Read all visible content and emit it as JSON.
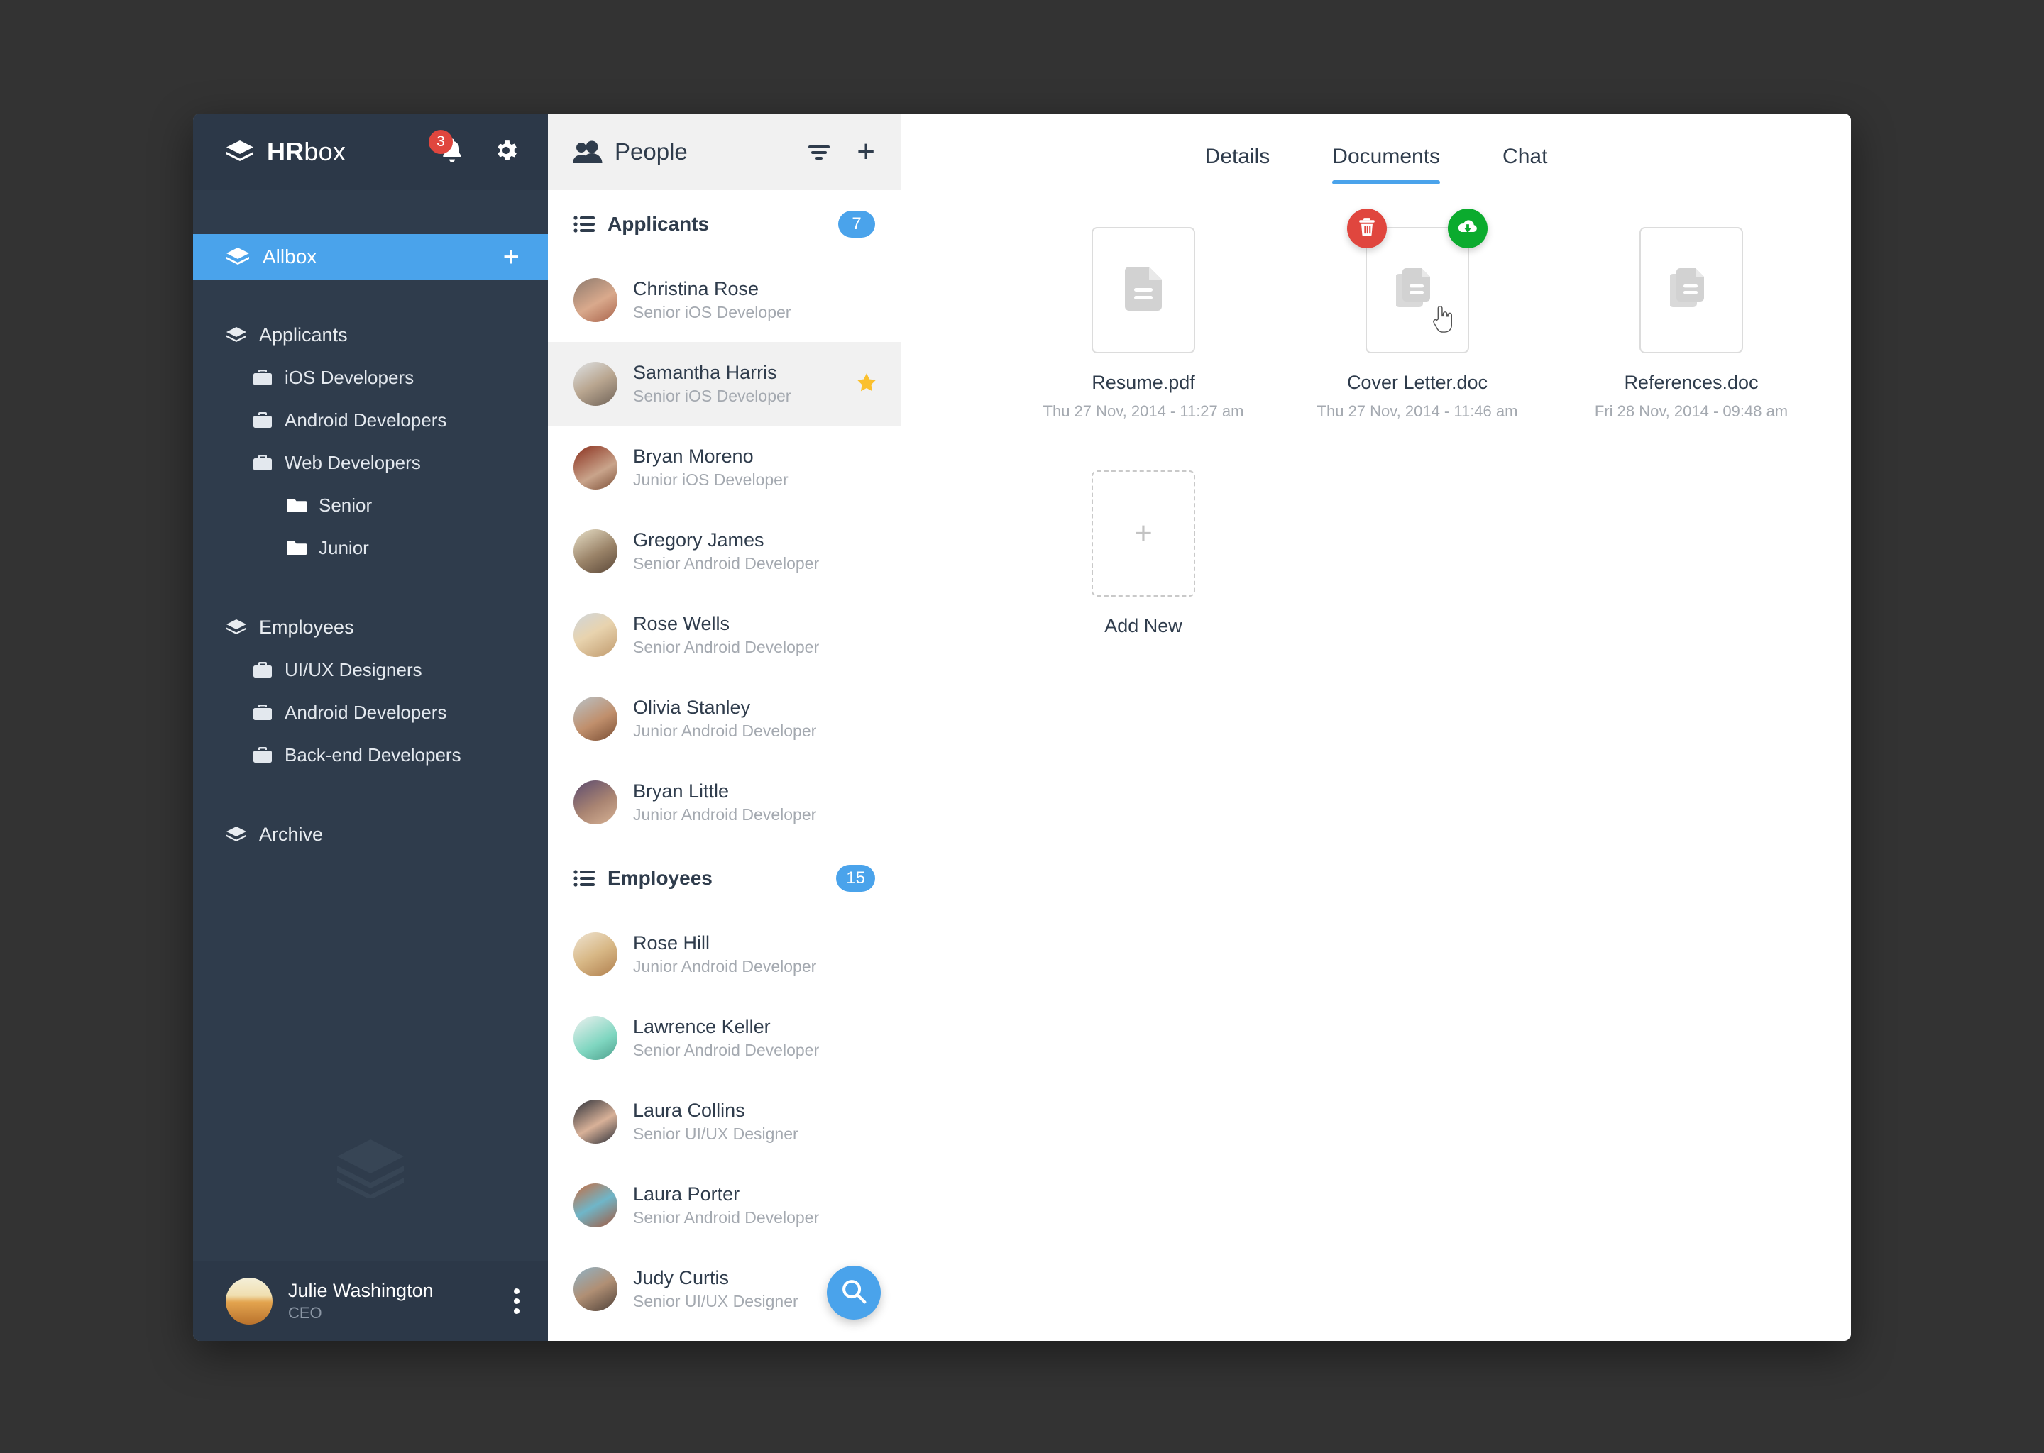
{
  "theme": {
    "accent_blue": "#4aa3eb",
    "sidebar_bg": "#2f3c4c",
    "sidebar_dark": "#2c3848",
    "danger_red": "#e0463e",
    "success_green": "#0bab2e",
    "star_gold": "#fbc02d",
    "desktop_bg": "#333333"
  },
  "sidebar": {
    "brand": {
      "bold": "HR",
      "light": "box",
      "logo_icon": "layers-icon"
    },
    "notifications": {
      "icon": "bell-icon",
      "count": "3"
    },
    "settings": {
      "icon": "gear-icon"
    },
    "allbox": {
      "label": "Allbox",
      "icon": "layers-icon",
      "add_label": "+"
    },
    "groups": [
      {
        "label": "Applicants",
        "icon": "layers-icon",
        "items": [
          {
            "label": "iOS Developers",
            "icon": "briefcase-icon"
          },
          {
            "label": "Android Developers",
            "icon": "briefcase-icon"
          },
          {
            "label": "Web Developers",
            "icon": "briefcase-icon"
          }
        ],
        "subitems": [
          {
            "label": "Senior",
            "icon": "folder-icon"
          },
          {
            "label": "Junior",
            "icon": "folder-icon"
          }
        ]
      },
      {
        "label": "Employees",
        "icon": "layers-icon",
        "items": [
          {
            "label": "UI/UX Designers",
            "icon": "briefcase-icon"
          },
          {
            "label": "Android Developers",
            "icon": "briefcase-icon"
          },
          {
            "label": "Back-end Developers",
            "icon": "briefcase-icon"
          }
        ],
        "subitems": []
      },
      {
        "label": "Archive",
        "icon": "layers-icon",
        "items": [],
        "subitems": []
      }
    ],
    "watermark_icon": "layers-icon",
    "user": {
      "name": "Julie Washington",
      "role": "CEO",
      "menu_icon": "more-vertical-icon",
      "avatar": "avatar-julie"
    }
  },
  "people": {
    "title": "People",
    "title_icon": "people-icon",
    "filter_icon": "filter-icon",
    "add_icon": "plus-icon",
    "search_fab_icon": "search-icon",
    "sections": [
      {
        "title": "Applicants",
        "icon": "list-icon",
        "badge": "7",
        "people": [
          {
            "name": "Christina Rose",
            "role": "Senior iOS Developer",
            "selected": false,
            "starred": false,
            "avatar_a": "#8d7a6e",
            "avatar_b": "#d9a98c"
          },
          {
            "name": "Samantha Harris",
            "role": "Senior iOS Developer",
            "selected": true,
            "starred": true,
            "avatar_a": "#dfe3e6",
            "avatar_b": "#6f6257"
          },
          {
            "name": "Bryan Moreno",
            "role": "Junior iOS Developer",
            "selected": false,
            "starred": false,
            "avatar_a": "#8a2f1d",
            "avatar_b": "#c9a48b"
          },
          {
            "name": "Gregory James",
            "role": "Senior Android Developer",
            "selected": false,
            "starred": false,
            "avatar_a": "#e8e0c8",
            "avatar_b": "#6d5a4a"
          },
          {
            "name": "Rose Wells",
            "role": "Senior Android Developer",
            "selected": false,
            "starred": false,
            "avatar_a": "#cfd6dc",
            "avatar_b": "#d6b98e"
          },
          {
            "name": "Olivia Stanley",
            "role": "Junior Android Developer",
            "selected": false,
            "starred": false,
            "avatar_a": "#b9c3c8",
            "avatar_b": "#8a5f44"
          },
          {
            "name": "Bryan Little",
            "role": "Junior Android Developer",
            "selected": false,
            "starred": false,
            "avatar_a": "#5b4a6e",
            "avatar_b": "#d7b294"
          }
        ]
      },
      {
        "title": "Employees",
        "icon": "list-icon",
        "badge": "15",
        "people": [
          {
            "name": "Rose Hill",
            "role": "Junior Android Developer",
            "selected": false,
            "starred": false,
            "avatar_a": "#efe4d2",
            "avatar_b": "#c8a071"
          },
          {
            "name": "Lawrence Keller",
            "role": "Senior Android Developer",
            "selected": false,
            "starred": false,
            "avatar_a": "#eef1f0",
            "avatar_b": "#7fd6c0"
          },
          {
            "name": "Laura Collins",
            "role": "Senior UI/UX Designer",
            "selected": false,
            "starred": false,
            "avatar_a": "#2b2f38",
            "avatar_b": "#d8b198"
          },
          {
            "name": "Laura Porter",
            "role": "Senior Android Developer",
            "selected": false,
            "starred": false,
            "avatar_a": "#c96a3d",
            "avatar_b": "#6fb6c9"
          },
          {
            "name": "Judy Curtis",
            "role": "Senior UI/UX Designer",
            "selected": false,
            "starred": false,
            "avatar_a": "#8fb3c7",
            "avatar_b": "#5b4b42"
          }
        ]
      }
    ]
  },
  "main": {
    "tabs": [
      {
        "label": "Details",
        "active": false
      },
      {
        "label": "Documents",
        "active": true
      },
      {
        "label": "Chat",
        "active": false
      }
    ],
    "documents": [
      {
        "name": "Resume.pdf",
        "date": "Thu 27 Nov, 2014 - 11:27 am",
        "icon": "document-icon",
        "hovered": false
      },
      {
        "name": "Cover Letter.doc",
        "date": "Thu 27 Nov, 2014 - 11:46 am",
        "icon": "documents-stack-icon",
        "hovered": true
      },
      {
        "name": "References.doc",
        "date": "Fri 28 Nov, 2014 - 09:48 am",
        "icon": "documents-stack-icon",
        "hovered": false
      }
    ],
    "doc_actions": {
      "delete": {
        "icon": "trash-icon",
        "color": "#e0463e"
      },
      "download": {
        "icon": "cloud-download-icon",
        "color": "#0bab2e"
      }
    },
    "add_new": {
      "label": "Add New",
      "icon": "plus-icon"
    },
    "cursor_icon": "pointing-hand-cursor"
  }
}
